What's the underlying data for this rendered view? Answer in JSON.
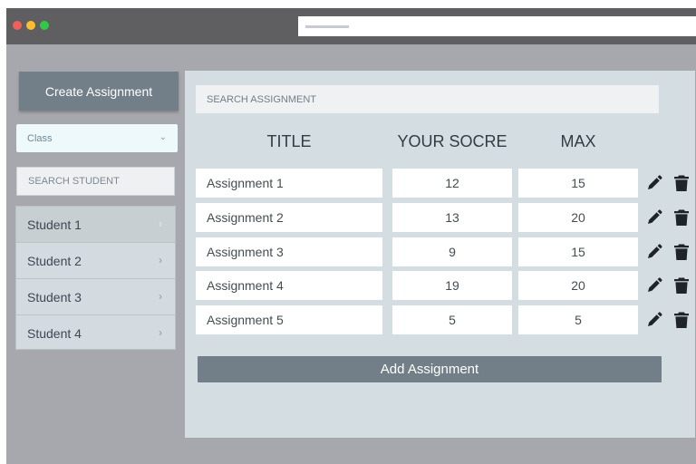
{
  "sidebar": {
    "create_label": "Create Assignment",
    "class_select": {
      "selected": "Class"
    },
    "search_placeholder": "SEARCH STUDENT",
    "students": [
      {
        "label": "Student 1",
        "active": true
      },
      {
        "label": "Student 2",
        "active": false
      },
      {
        "label": "Student 3",
        "active": false
      },
      {
        "label": "Student 4",
        "active": false
      }
    ]
  },
  "main": {
    "search_placeholder": "SEARCH ASSIGNMENT",
    "columns": {
      "title": "TITLE",
      "score": "YOUR SOCRE",
      "max": "MAX"
    },
    "rows": [
      {
        "title": "Assignment 1",
        "score": "12",
        "max": "15"
      },
      {
        "title": "Assignment 2",
        "score": "13",
        "max": "20"
      },
      {
        "title": "Assignment 3",
        "score": "9",
        "max": "15"
      },
      {
        "title": "Assignment 4",
        "score": "19",
        "max": "20"
      },
      {
        "title": "Assignment 5",
        "score": "5",
        "max": "5"
      }
    ],
    "add_label": "Add Assignment"
  },
  "icons": {
    "edit": "pencil-icon",
    "delete": "trash-icon",
    "chevron": "chevron-right-icon",
    "dropdown": "chevron-down-icon"
  },
  "colors": {
    "button": "#727f88",
    "panel": "#d4dde2",
    "window_bg": "#a7a8ae",
    "titlebar": "#5f5f61"
  }
}
